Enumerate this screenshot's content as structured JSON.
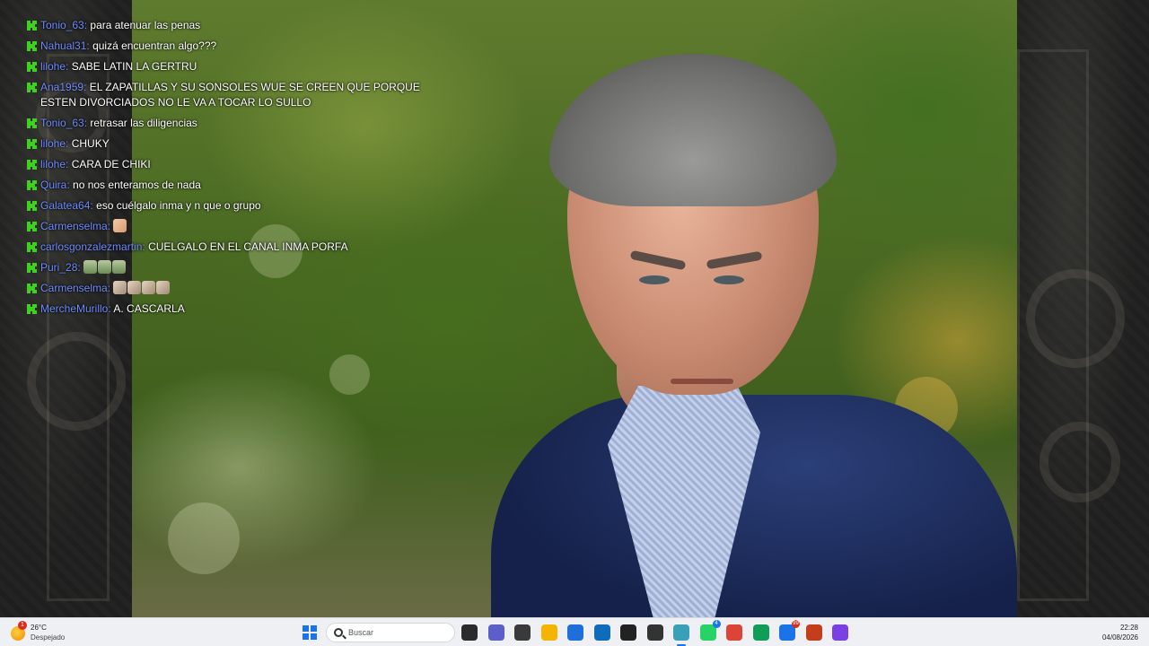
{
  "chat": {
    "messages": [
      {
        "user": "Tonio_63",
        "text": "para atenuar las penas"
      },
      {
        "user": "Nahual31",
        "text": "quizá encuentran algo???"
      },
      {
        "user": "lilohe",
        "text": "SABE LATIN LA GERTRU"
      },
      {
        "user": "Ana1959",
        "text": "EL ZAPATILLAS Y SU SONSOLES WUE SE CREEN QUE PORQUE ESTEN DIVORCIADOS NO LE VA A TOCAR LO SULLO"
      },
      {
        "user": "Tonio_63",
        "text": "retrasar las diligencias"
      },
      {
        "user": "lilohe",
        "text": "CHUKY"
      },
      {
        "user": "lilohe",
        "text": "CARA DE CHIKI"
      },
      {
        "user": "Quira",
        "text": "no nos enteramos de nada"
      },
      {
        "user": "Galatea64",
        "text": "eso cuélgalo inma y n que o grupo"
      },
      {
        "user": "Carmenselma",
        "text": ""
      },
      {
        "user": "carlosgonzalezmartin",
        "text": "CUELGALO EN EL CANAL INMA PORFA"
      },
      {
        "user": "Puri_28",
        "text": ""
      },
      {
        "user": "Carmenselma",
        "text": ""
      },
      {
        "user": "MercheMurillo",
        "text": "A. CASCARLA"
      }
    ],
    "separator": ":",
    "badge_color": "#3fd11f",
    "username_color": "#6f8cff"
  },
  "taskbar": {
    "weather": {
      "temp": "26°C",
      "desc": "Despejado",
      "alert_count": "1"
    },
    "search_placeholder": "Buscar",
    "apps": [
      {
        "name": "task-view",
        "color": "#2b2b2b"
      },
      {
        "name": "teams",
        "color": "#5b5fc7"
      },
      {
        "name": "app-dark",
        "color": "#3a3a3a"
      },
      {
        "name": "file-explorer",
        "color": "#f4b400"
      },
      {
        "name": "microsoft-store",
        "color": "#1e6fd9"
      },
      {
        "name": "outlook",
        "color": "#0f6cbd"
      },
      {
        "name": "app-record",
        "color": "#222222"
      },
      {
        "name": "app-cube",
        "color": "#333333"
      },
      {
        "name": "app-active",
        "color": "#3aa0b8"
      },
      {
        "name": "whatsapp",
        "color": "#25d366",
        "badge": "4"
      },
      {
        "name": "chrome",
        "color": "#db4437"
      },
      {
        "name": "chrome-2",
        "color": "#0f9d58"
      },
      {
        "name": "app-globe",
        "color": "#1a73e8",
        "badge": "99"
      },
      {
        "name": "powerpoint",
        "color": "#c43e1c"
      },
      {
        "name": "app-circle",
        "color": "#7b3fe4"
      }
    ],
    "time": "22:28",
    "date": "04/08/2026"
  }
}
